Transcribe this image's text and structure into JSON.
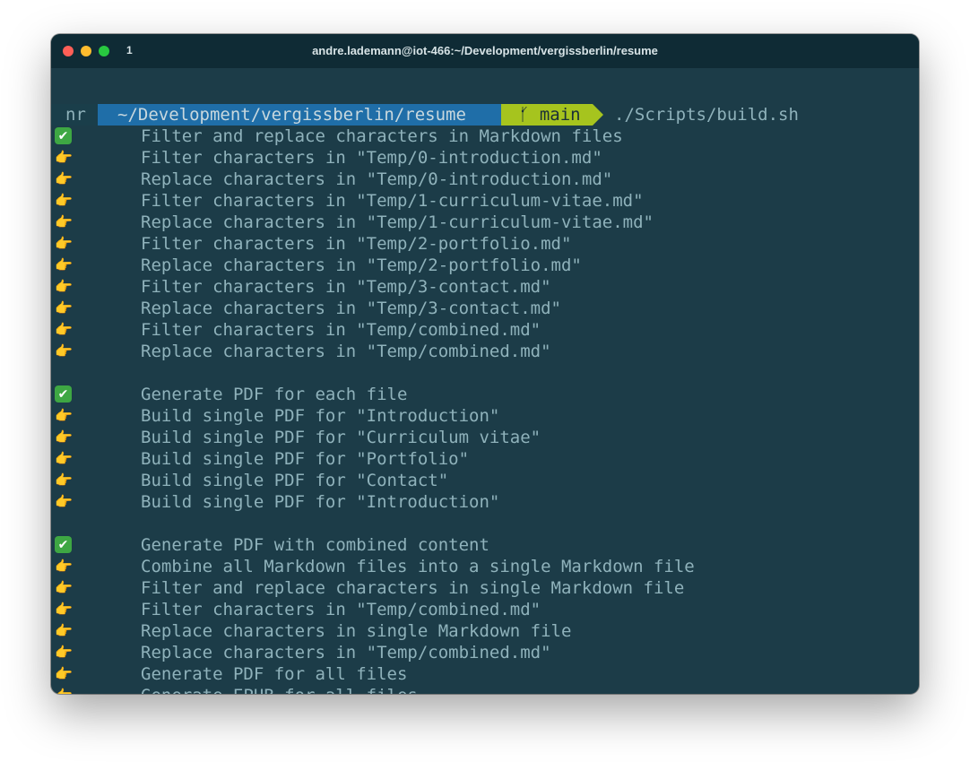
{
  "window": {
    "tab_index": "1",
    "title": "andre.lademann@iot-466:~/Development/vergissberlin/resume"
  },
  "prompt": {
    "host": "nr",
    "path": "~/Development/vergissberlin/resume",
    "branch_icon": "git-branch-icon",
    "branch_glyph": "ᚶ",
    "branch": "main",
    "command": "./Scripts/build.sh"
  },
  "output": [
    {
      "icon": "check-icon",
      "glyph": "✔",
      "text": "Filter and replace characters in Markdown files"
    },
    {
      "icon": "pointing-hand-icon",
      "glyph": "👉",
      "text": "Filter characters in \"Temp/0-introduction.md\""
    },
    {
      "icon": "pointing-hand-icon",
      "glyph": "👉",
      "text": "Replace characters in \"Temp/0-introduction.md\""
    },
    {
      "icon": "pointing-hand-icon",
      "glyph": "👉",
      "text": "Filter characters in \"Temp/1-curriculum-vitae.md\""
    },
    {
      "icon": "pointing-hand-icon",
      "glyph": "👉",
      "text": "Replace characters in \"Temp/1-curriculum-vitae.md\""
    },
    {
      "icon": "pointing-hand-icon",
      "glyph": "👉",
      "text": "Filter characters in \"Temp/2-portfolio.md\""
    },
    {
      "icon": "pointing-hand-icon",
      "glyph": "👉",
      "text": "Replace characters in \"Temp/2-portfolio.md\""
    },
    {
      "icon": "pointing-hand-icon",
      "glyph": "👉",
      "text": "Filter characters in \"Temp/3-contact.md\""
    },
    {
      "icon": "pointing-hand-icon",
      "glyph": "👉",
      "text": "Replace characters in \"Temp/3-contact.md\""
    },
    {
      "icon": "pointing-hand-icon",
      "glyph": "👉",
      "text": "Filter characters in \"Temp/combined.md\""
    },
    {
      "icon": "pointing-hand-icon",
      "glyph": "👉",
      "text": "Replace characters in \"Temp/combined.md\""
    },
    {
      "icon": "",
      "glyph": "",
      "text": ""
    },
    {
      "icon": "check-icon",
      "glyph": "✔",
      "text": "Generate PDF for each file"
    },
    {
      "icon": "pointing-hand-icon",
      "glyph": "👉",
      "text": "Build single PDF for \"Introduction\""
    },
    {
      "icon": "pointing-hand-icon",
      "glyph": "👉",
      "text": "Build single PDF for \"Curriculum vitae\""
    },
    {
      "icon": "pointing-hand-icon",
      "glyph": "👉",
      "text": "Build single PDF for \"Portfolio\""
    },
    {
      "icon": "pointing-hand-icon",
      "glyph": "👉",
      "text": "Build single PDF for \"Contact\""
    },
    {
      "icon": "pointing-hand-icon",
      "glyph": "👉",
      "text": "Build single PDF for \"Introduction\""
    },
    {
      "icon": "",
      "glyph": "",
      "text": ""
    },
    {
      "icon": "check-icon",
      "glyph": "✔",
      "text": "Generate PDF with combined content"
    },
    {
      "icon": "pointing-hand-icon",
      "glyph": "👉",
      "text": "Combine all Markdown files into a single Markdown file"
    },
    {
      "icon": "pointing-hand-icon",
      "glyph": "👉",
      "text": "Filter and replace characters in single Markdown file"
    },
    {
      "icon": "pointing-hand-icon",
      "glyph": "👉",
      "text": "Filter characters in \"Temp/combined.md\""
    },
    {
      "icon": "pointing-hand-icon",
      "glyph": "👉",
      "text": "Replace characters in single Markdown file"
    },
    {
      "icon": "pointing-hand-icon",
      "glyph": "👉",
      "text": "Replace characters in \"Temp/combined.md\""
    },
    {
      "icon": "pointing-hand-icon",
      "glyph": "👉",
      "text": "Generate PDF for all files"
    },
    {
      "icon": "pointing-hand-icon",
      "glyph": "👉",
      "text": "Generate EPUB for all files"
    }
  ],
  "colors": {
    "background": "#1c3c48",
    "titlebar": "#0f2b35",
    "text": "#8fb2bb",
    "path_segment": "#1f6ea8",
    "git_segment": "#a6c41e",
    "check_green": "#3ea743"
  }
}
